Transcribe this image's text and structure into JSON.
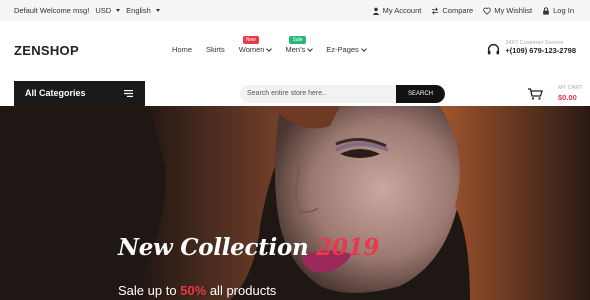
{
  "topbar": {
    "welcome": "Default Welcome msg!",
    "currency": "USD",
    "language": "English",
    "links": [
      {
        "label": "My Account",
        "icon": "user-icon"
      },
      {
        "label": "Compare",
        "icon": "compare-icon"
      },
      {
        "label": "My Wishlist",
        "icon": "heart-icon"
      },
      {
        "label": "Log In",
        "icon": "lock-icon"
      }
    ]
  },
  "header": {
    "logo": "ZENSHOP",
    "nav": [
      {
        "label": "Home"
      },
      {
        "label": "Skirts"
      },
      {
        "label": "Women",
        "badge": "New"
      },
      {
        "label": "Men's",
        "badge": "Sale"
      },
      {
        "label": "Ez-Pages"
      }
    ],
    "support_label": "24X7 Customer Service",
    "support_phone": "+(109) 679-123-2798"
  },
  "search": {
    "categories_label": "All Categories",
    "placeholder": "Search entire store here..",
    "button": "SEARCH"
  },
  "cart": {
    "label": "MY CART",
    "amount": "$0.00"
  },
  "hero": {
    "title_main": "New Collection",
    "title_year": "2019",
    "sub_prefix": "Sale up to",
    "sub_pct": "50%",
    "sub_suffix": "all products"
  },
  "colors": {
    "accent": "#e8394a",
    "sale": "#27b67a",
    "dark": "#1a1a1a"
  }
}
